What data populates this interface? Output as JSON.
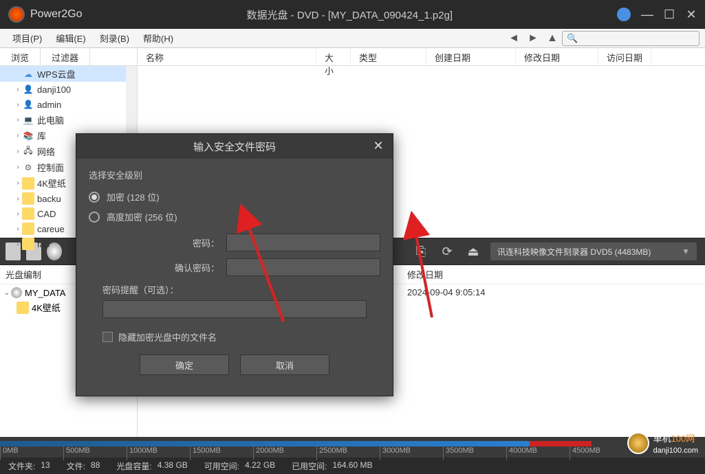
{
  "app": {
    "name": "Power2Go",
    "title": "数据光盘 - DVD - [MY_DATA_090424_1.p2g]"
  },
  "menu": {
    "project": "项目(P)",
    "edit": "编辑(E)",
    "burn": "刻录(B)",
    "help": "帮助(H)"
  },
  "tabs": {
    "browse": "浏览",
    "filter": "过滤器"
  },
  "cols": {
    "name": "名称",
    "size": "大小",
    "type": "类型",
    "created": "创建日期",
    "modified": "修改日期",
    "accessed": "访问日期"
  },
  "tree": {
    "items": [
      {
        "label": "WPS云盘",
        "icon": "cloud"
      },
      {
        "label": "danji100",
        "icon": "user"
      },
      {
        "label": "admin",
        "icon": "user"
      },
      {
        "label": "此电脑",
        "icon": "pc"
      },
      {
        "label": "库",
        "icon": "lib"
      },
      {
        "label": "网络",
        "icon": "net"
      },
      {
        "label": "控制面",
        "icon": "ctrl"
      },
      {
        "label": "4K壁纸",
        "icon": "folder"
      },
      {
        "label": "backu",
        "icon": "folder"
      },
      {
        "label": "CAD",
        "icon": "folder"
      },
      {
        "label": "careue",
        "icon": "folder"
      },
      {
        "label": "fab",
        "icon": "folder"
      }
    ]
  },
  "device": "讯连科技映像文件刻录器 DVD5 (4483MB)",
  "compile": {
    "header": "光盘编制",
    "root": "MY_DATA",
    "child": "4K壁纸",
    "cols": {
      "modified": "修改日期"
    },
    "date": "2024-09-04 9:05:14"
  },
  "capacity": {
    "ticks": [
      "0MB",
      "500MB",
      "1000MB",
      "1500MB",
      "2000MB",
      "2500MB",
      "3000MB",
      "3500MB",
      "4000MB",
      "4500MB"
    ]
  },
  "status": {
    "folders_label": "文件夹:",
    "folders": "13",
    "files_label": "文件:",
    "files": "88",
    "cap_label": "光盘容量:",
    "cap": "4.38 GB",
    "free_label": "可用空间:",
    "free": "4.22 GB",
    "used_label": "已用空间:",
    "used": "164.60 MB"
  },
  "watermark": {
    "text": "danji100.com"
  },
  "dialog": {
    "title": "输入安全文件密码",
    "section_label": "选择安全级别",
    "opt1": "加密 (128 位)",
    "opt2": "高度加密 (256 位)",
    "pwd_label": "密码：",
    "confirm_label": "确认密码：",
    "hint_label": "密码提醒（可选）：",
    "hide_label": "隐藏加密光盘中的文件名",
    "ok": "确定",
    "cancel": "取消"
  }
}
